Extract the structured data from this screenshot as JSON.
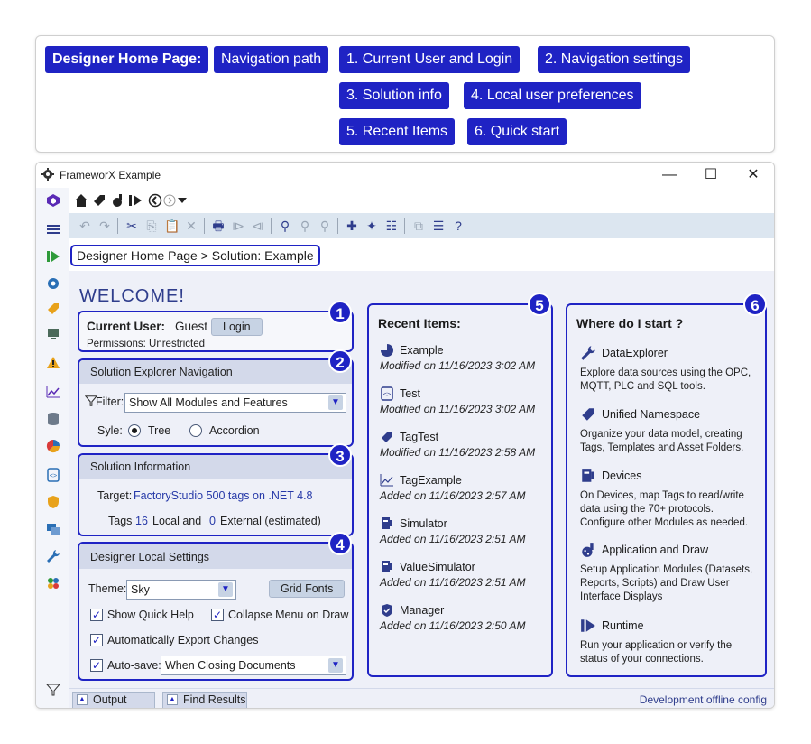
{
  "legend": {
    "chips": {
      "home": "Designer Home Page:",
      "nav_path": "Navigation path",
      "c1": "1. Current User and Login",
      "c2": "2. Navigation settings",
      "c3": "3. Solution info",
      "c4": "4. Local user preferences",
      "c5": "5. Recent Items",
      "c6": "6. Quick start"
    }
  },
  "window": {
    "title": "FrameworX Example",
    "minimize": "—",
    "maximize": "☐",
    "close": "✕"
  },
  "breadcrumb": "Designer Home Page > Solution: Example",
  "welcome": "WELCOME!",
  "badges": [
    "1",
    "2",
    "3",
    "4",
    "5",
    "6"
  ],
  "user_panel": {
    "label": "Current User:",
    "user": "Guest",
    "login": "Login",
    "permissions": "Permissions: Unrestricted"
  },
  "nav_panel": {
    "title": "Solution Explorer Navigation",
    "filter_label": "Filter:",
    "filter_value": "Show All Modules and Features",
    "style_label": "Syle:",
    "opt_tree": "Tree",
    "opt_accordion": "Accordion",
    "selected": "Tree"
  },
  "info_panel": {
    "title": "Solution Information",
    "target_label": "Target:",
    "target_value": "FactoryStudio 500 tags on .NET 4.8",
    "tags_label": "Tags",
    "tags_local": "16",
    "local_text": "Local and",
    "tags_external": "0",
    "external_text": "External (estimated)"
  },
  "local_panel": {
    "title": "Designer Local Settings",
    "theme_label": "Theme:",
    "theme_value": "Sky",
    "grid_fonts": "Grid Fonts",
    "show_quick_help": "Show Quick Help",
    "collapse_menu": "Collapse Menu on Draw",
    "auto_export": "Automatically Export Changes",
    "autosave_label": "Auto-save:",
    "autosave_value": "When Closing Documents"
  },
  "recent": {
    "title": "Recent Items:",
    "items": [
      {
        "name": "Example",
        "date": "Modified on 11/16/2023 3:02 AM",
        "icon": "solution-icon"
      },
      {
        "name": "Test",
        "date": "Modified on 11/16/2023 3:02 AM",
        "icon": "script-icon"
      },
      {
        "name": "TagTest",
        "date": "Modified on 11/16/2023 2:58 AM",
        "icon": "tag-icon"
      },
      {
        "name": "TagExample",
        "date": "Added on 11/16/2023 2:57 AM",
        "icon": "trend-icon"
      },
      {
        "name": "Simulator",
        "date": "Added on 11/16/2023 2:51 AM",
        "icon": "device-icon"
      },
      {
        "name": "ValueSimulator",
        "date": "Added on 11/16/2023 2:51 AM",
        "icon": "device-icon"
      },
      {
        "name": "Manager",
        "date": "Added on 11/16/2023 2:50 AM",
        "icon": "security-icon"
      }
    ]
  },
  "start": {
    "title": "Where do I start ?",
    "items": [
      {
        "name": "DataExplorer",
        "desc": "Explore data sources using the  OPC, MQTT, PLC and SQL tools.",
        "icon": "wrench-icon"
      },
      {
        "name": "Unified Namespace",
        "desc": "Organize your data model, creating Tags, Templates and Asset Folders.",
        "icon": "tag-icon"
      },
      {
        "name": "Devices",
        "desc": "On Devices, map Tags to read/write data using the 70+ protocols. Configure other Modules as needed.",
        "icon": "device-icon"
      },
      {
        "name": "Application and Draw",
        "desc": "Setup Application Modules (Datasets, Reports, Scripts) and Draw User Interface Displays",
        "icon": "palette-icon"
      },
      {
        "name": "Runtime",
        "desc": "Run your application or verify the status of your connections.",
        "icon": "runtime-icon"
      }
    ]
  },
  "statusbar": {
    "output": "Output",
    "find_results": "Find Results",
    "right": "Development offline config"
  },
  "colors": {
    "accent": "#1f23c4",
    "panel_bg": "#eef0f8",
    "toolbar_bg": "#dce6f0"
  }
}
